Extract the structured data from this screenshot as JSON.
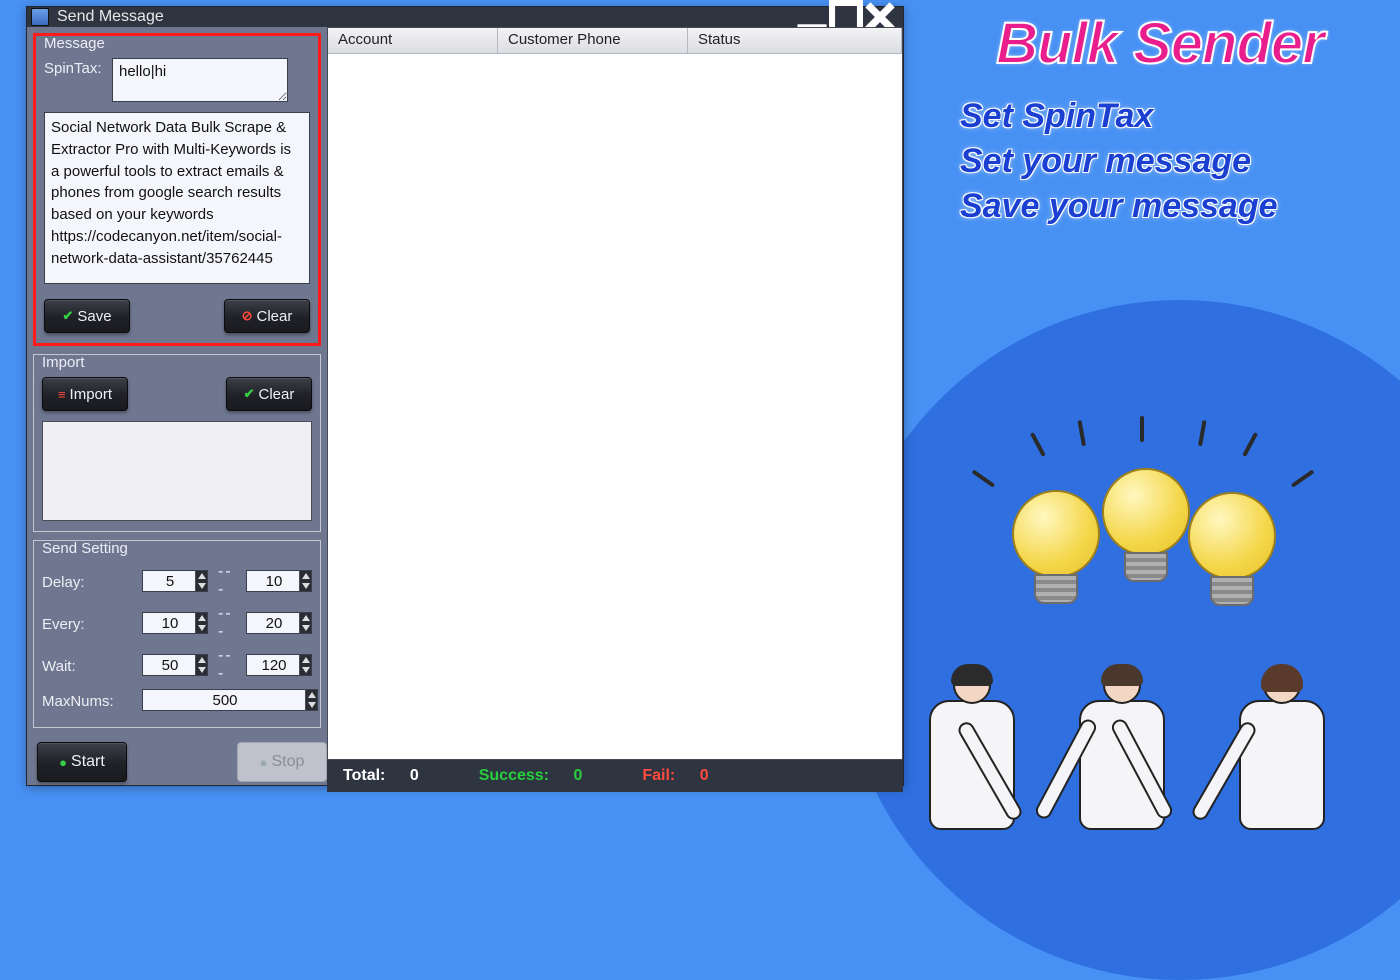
{
  "window": {
    "title": "Send Message"
  },
  "message_group": {
    "legend": "Message",
    "spintax_label": "SpinTax:",
    "spintax_value": "hello|hi",
    "body": "Social Network Data Bulk Scrape & Extractor Pro with Multi-Keywords is a powerful tools to extract emails & phones from google search results based on your keywords https://codecanyon.net/item/social-network-data-assistant/35762445",
    "save_label": "Save",
    "clear_label": "Clear"
  },
  "import_group": {
    "legend": "Import",
    "import_label": "Import",
    "clear_label": "Clear"
  },
  "settings_group": {
    "legend": "Send Setting",
    "delay_label": "Delay:",
    "delay_min": "5",
    "delay_max": "10",
    "every_label": "Every:",
    "every_min": "10",
    "every_max": "20",
    "wait_label": "Wait:",
    "wait_min": "50",
    "wait_max": "120",
    "maxnums_label": "MaxNums:",
    "maxnums": "500"
  },
  "actions": {
    "start_label": "Start",
    "stop_label": "Stop"
  },
  "table": {
    "columns": [
      "Account",
      "Customer Phone",
      "Status"
    ]
  },
  "statusbar": {
    "total_label": "Total:",
    "total_value": "0",
    "success_label": "Success:",
    "success_value": "0",
    "fail_label": "Fail:",
    "fail_value": "0"
  },
  "promo": {
    "title": "Bulk Sender",
    "lines": [
      "Set  SpinTax",
      "Set your message",
      "Save your message"
    ]
  }
}
